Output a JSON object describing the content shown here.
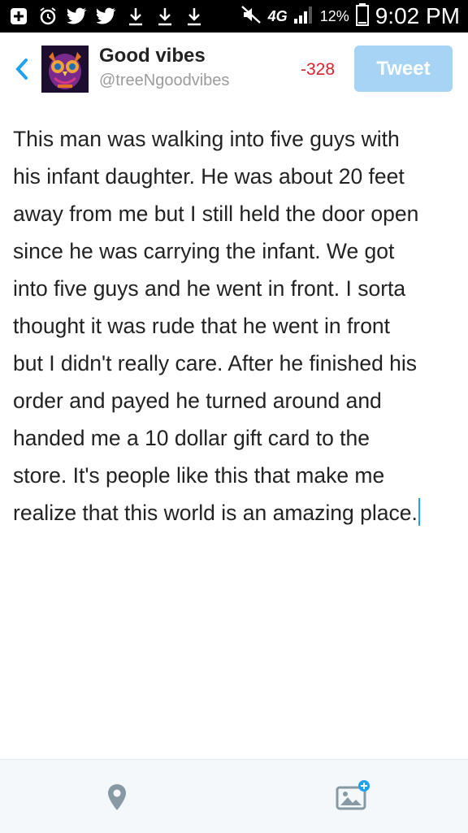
{
  "status_bar": {
    "network": "4G",
    "battery": "12%",
    "time": "9:02 PM"
  },
  "header": {
    "display_name": "Good vibes",
    "handle": "@treeNgoodvibes",
    "char_count": "-328",
    "tweet_label": "Tweet"
  },
  "compose": {
    "lines": [
      "This man was walking into five guys with",
      "his infant daughter.  He was about 20 feet",
      "away from me but I still held the door open",
      "since he was carrying the infant.  We got",
      "into five guys and he went in front. I sorta",
      "thought it was rude that he went in front",
      "but I didn't really care.  After he finished his",
      "order and payed he turned around and",
      "handed me a 10 dollar gift card to the",
      "store. It's people like this that make me",
      "realize that this world is an amazing place."
    ]
  },
  "colors": {
    "accent": "#1da1f2",
    "tweet_button": "#a7d4f4",
    "over_limit": "#d9212c"
  }
}
